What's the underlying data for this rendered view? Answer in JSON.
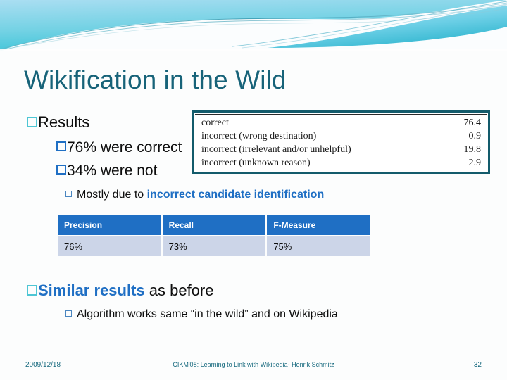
{
  "slide": {
    "title": "Wikification in the Wild",
    "theme": {
      "title_color": "#176379",
      "accent_blue": "#1f6fc4",
      "accent_cyan": "#4ec6d4",
      "header_teal": "#3fc3d6",
      "header_light_blue": "#a9dcf0",
      "table_header_bg": "#1f6fc4",
      "table_row_bg": "#ccd5e8",
      "footer_color": "#16697e",
      "figure_border": "#135b6b"
    }
  },
  "content": {
    "bullet_results": "Results",
    "bullet_correct": "76% were correct",
    "bullet_not": "34% were not",
    "bullet_mostly_prefix": "Mostly due to ",
    "bullet_mostly_accent": "incorrect candidate identification",
    "bullet_similar_accent": "Similar results",
    "bullet_similar_suffix": " as before",
    "bullet_algorithm": "Algorithm works same “in the wild” and on Wikipedia"
  },
  "paper_figure": {
    "rows": [
      {
        "label": "correct",
        "value": "76.4"
      },
      {
        "label": "incorrect (wrong destination)",
        "value": "0.9"
      },
      {
        "label": "incorrect (irrelevant and/or unhelpful)",
        "value": "19.8"
      },
      {
        "label": "incorrect (unknown reason)",
        "value": "2.9"
      }
    ]
  },
  "metrics_table": {
    "headers": [
      "Precision",
      "Recall",
      "F-Measure"
    ],
    "row": [
      "76%",
      "73%",
      "75%"
    ]
  },
  "footer": {
    "date": "2009/12/18",
    "center": "CIKM'08: Learning to Link with Wikipedia- Henrik Schmitz",
    "page": "32"
  }
}
